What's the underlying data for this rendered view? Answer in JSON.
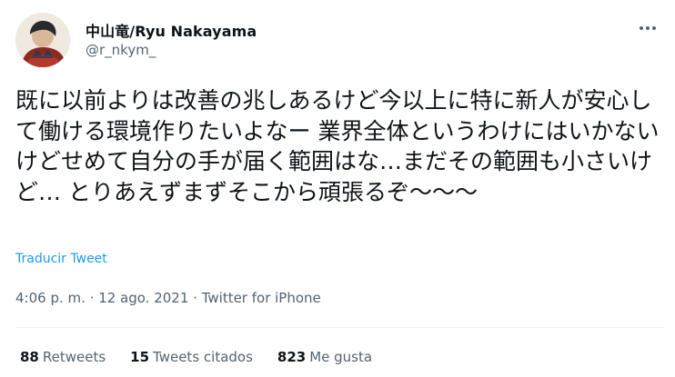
{
  "user": {
    "display_name": "中山竜/Ryu Nakayama",
    "handle": "@r_nkym_"
  },
  "tweet": {
    "text": "既に以前よりは改善の兆しあるけど今以上に特に新人が安心して働ける環境作りたいよなー 業界全体というわけにはいかないけどせめて自分の手が届く範囲はな…まだその範囲も小さいけど… とりあえずまずそこから頑張るぞ〜〜〜",
    "translate_label": "Traducir Tweet",
    "timestamp": "4:06 p. m. · 12 ago. 2021 · ",
    "source": "Twitter for iPhone"
  },
  "stats": {
    "retweets_count": "88",
    "retweets_label": "Retweets",
    "quotes_count": "15",
    "quotes_label": "Tweets citados",
    "likes_count": "823",
    "likes_label": "Me gusta"
  },
  "icons": {
    "more": "more-dots-icon",
    "avatar": "avatar-image"
  },
  "colors": {
    "link": "#1d9bf0",
    "secondary_text": "#536471",
    "primary_text": "#0f1419"
  }
}
